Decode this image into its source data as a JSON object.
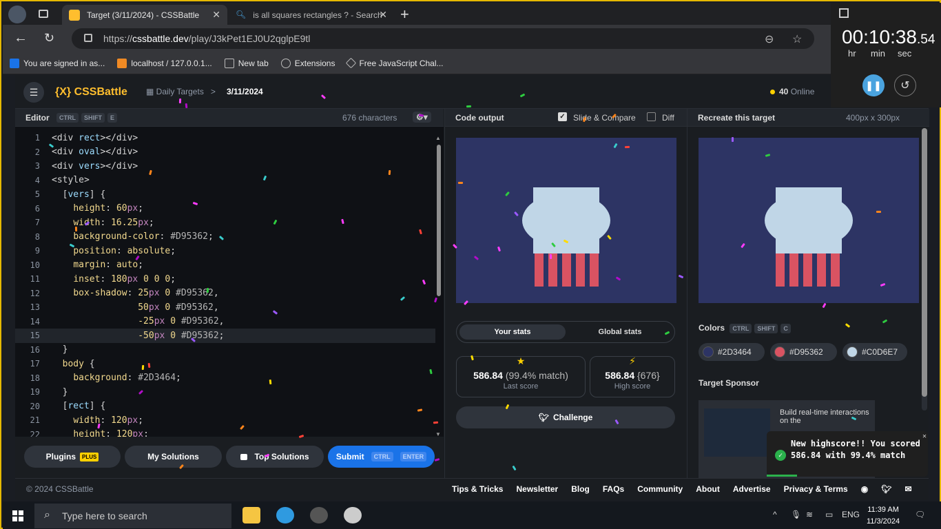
{
  "browser": {
    "tabs": [
      {
        "title": "Target (3/11/2024) - CSSBattle",
        "active": true,
        "favicon_color": "#ffbe2e"
      },
      {
        "title": "is all squares rectangles ? - Search",
        "active": false,
        "favicon_color": "#4aa3df"
      }
    ],
    "url_prefix": "https://",
    "url_host": "cssbattle.dev",
    "url_path": "/play/J3kPet1EJ0U2qglpE9tl",
    "bookmarks": [
      {
        "label": "You are signed in as...",
        "icon": "s-icon",
        "color": "#1a73e8"
      },
      {
        "label": "localhost / 127.0.0.1...",
        "icon": "phpmyadmin-icon",
        "color": "#f08a24"
      },
      {
        "label": "New tab",
        "icon": "newtab-icon",
        "color": "#bbbbbb"
      },
      {
        "label": "Extensions",
        "icon": "puzzle-icon",
        "color": "#bbbbbb"
      },
      {
        "label": "Free JavaScript Chal...",
        "icon": "cube-icon",
        "color": "#bbbbbb"
      }
    ]
  },
  "timer": {
    "hhmmss": "00:10:38",
    "fraction": ".54",
    "labels": {
      "hr": "hr",
      "min": "min",
      "sec": "sec"
    }
  },
  "app": {
    "logo": "{X} CSSBattle",
    "crumb": "Daily Targets",
    "crumb_sep": ">",
    "date": "3/11/2024",
    "online_count": "40",
    "online_label": "Online"
  },
  "editor": {
    "title": "Editor",
    "shortcut": [
      "CTRL",
      "SHIFT",
      "E"
    ],
    "chars": "676 characters",
    "lines": [
      {
        "n": "1",
        "html": "<span class='tg'>&lt;div</span> <span class='at'>rect</span><span class='tg'>&gt;&lt;/div&gt;</span>"
      },
      {
        "n": "2",
        "html": "<span class='tg'>&lt;div</span> <span class='at'>oval</span><span class='tg'>&gt;&lt;/div&gt;</span>"
      },
      {
        "n": "3",
        "html": "<span class='tg'>&lt;div</span> <span class='at'>vers</span><span class='tg'>&gt;&lt;/div&gt;</span>"
      },
      {
        "n": "4",
        "html": "<span class='tg'>&lt;style&gt;</span>"
      },
      {
        "n": "5",
        "html": "  <span class='tg'>[</span><span class='at'>vers</span><span class='tg'>] {</span>"
      },
      {
        "n": "6",
        "html": "    <span class='pr'>height</span>: <span class='vl'>60</span><span class='un'>px</span>;"
      },
      {
        "n": "7",
        "html": "    <span class='pr'>width</span>: <span class='vl'>16.25</span><span class='un'>px</span>;"
      },
      {
        "n": "8",
        "html": "    <span class='pr'>background-color</span>: <span class='hx'>#D95362</span>;"
      },
      {
        "n": "9",
        "html": "    <span class='pr'>position</span>: <span class='vl'>absolute</span>;"
      },
      {
        "n": "10",
        "html": "    <span class='pr'>margin</span>: <span class='vl'>auto</span>;"
      },
      {
        "n": "11",
        "html": "    <span class='pr'>inset</span>: <span class='vl'>180</span><span class='un'>px</span> <span class='vl'>0 0 0</span>;"
      },
      {
        "n": "12",
        "html": "    <span class='pr'>box-shadow</span>: <span class='vl'>25</span><span class='un'>px</span> <span class='vl'>0</span> <span class='hx'>#D95362</span>,"
      },
      {
        "n": "13",
        "html": "                <span class='vl'>50</span><span class='un'>px</span> <span class='vl'>0</span> <span class='hx'>#D95362</span>,"
      },
      {
        "n": "14",
        "html": "                <span class='vl'>-25</span><span class='un'>px</span> <span class='vl'>0</span> <span class='hx'>#D95362</span>,"
      },
      {
        "n": "15",
        "html": "                <span class='vl'>-50</span><span class='un'>px</span> <span class='vl'>0</span> <span class='hx'>#D95362</span>;"
      },
      {
        "n": "16",
        "html": "  <span class='tg'>}</span>"
      },
      {
        "n": "17",
        "html": "  <span class='pr'>body</span> <span class='tg'>{</span>"
      },
      {
        "n": "18",
        "html": "    <span class='pr'>background</span>: <span class='hx'>#2D3464</span>;"
      },
      {
        "n": "19",
        "html": "  <span class='tg'>}</span>"
      },
      {
        "n": "20",
        "html": "  <span class='tg'>[</span><span class='at'>rect</span><span class='tg'>] {</span>"
      },
      {
        "n": "21",
        "html": "    <span class='pr'>width</span>: <span class='vl'>120</span><span class='un'>px</span>;"
      },
      {
        "n": "22",
        "html": "    <span class='pr'>height</span>: <span class='vl'>120</span><span class='un'>px</span>;"
      }
    ],
    "buttons": {
      "plugins": "Plugins",
      "plugins_badge": "PLUS",
      "my_solutions": "My Solutions",
      "top_solutions": "Top Solutions",
      "submit": "Submit",
      "submit_keys": [
        "CTRL",
        "ENTER"
      ]
    }
  },
  "output": {
    "title": "Code output",
    "slide_compare": "Slide & Compare",
    "slide_checked": true,
    "diff": "Diff",
    "diff_checked": false,
    "tabs": {
      "yours": "Your stats",
      "global": "Global stats"
    },
    "last_score": {
      "value": "586.84",
      "detail": "(99.4% match)",
      "label": "Last score",
      "icon": "star-icon"
    },
    "high_score": {
      "value": "586.84",
      "detail": "{676}",
      "label": "High score",
      "icon": "lightning-icon"
    },
    "challenge": "Challenge"
  },
  "target": {
    "title": "Recreate this target",
    "size": "400px x 300px",
    "colors_title": "Colors",
    "colors_keys": [
      "CTRL",
      "SHIFT",
      "C"
    ],
    "colors": [
      {
        "hex": "#2D3464"
      },
      {
        "hex": "#D95362"
      },
      {
        "hex": "#C0D6E7"
      }
    ],
    "sponsor_title": "Target Sponsor",
    "sponsor_text": "Build real-time interactions on the"
  },
  "toast": {
    "message": "New highscore!! You scored 586.84 with 99.4% match"
  },
  "footer": {
    "copyright": "© 2024 CSSBattle",
    "links": [
      "Tips & Tricks",
      "Newsletter",
      "Blog",
      "FAQs",
      "Community",
      "About",
      "Advertise",
      "Privacy & Terms"
    ]
  },
  "taskbar": {
    "search_placeholder": "Type here to search",
    "time": "11:39 AM",
    "date": "11/3/2024",
    "lang": "ENG"
  }
}
